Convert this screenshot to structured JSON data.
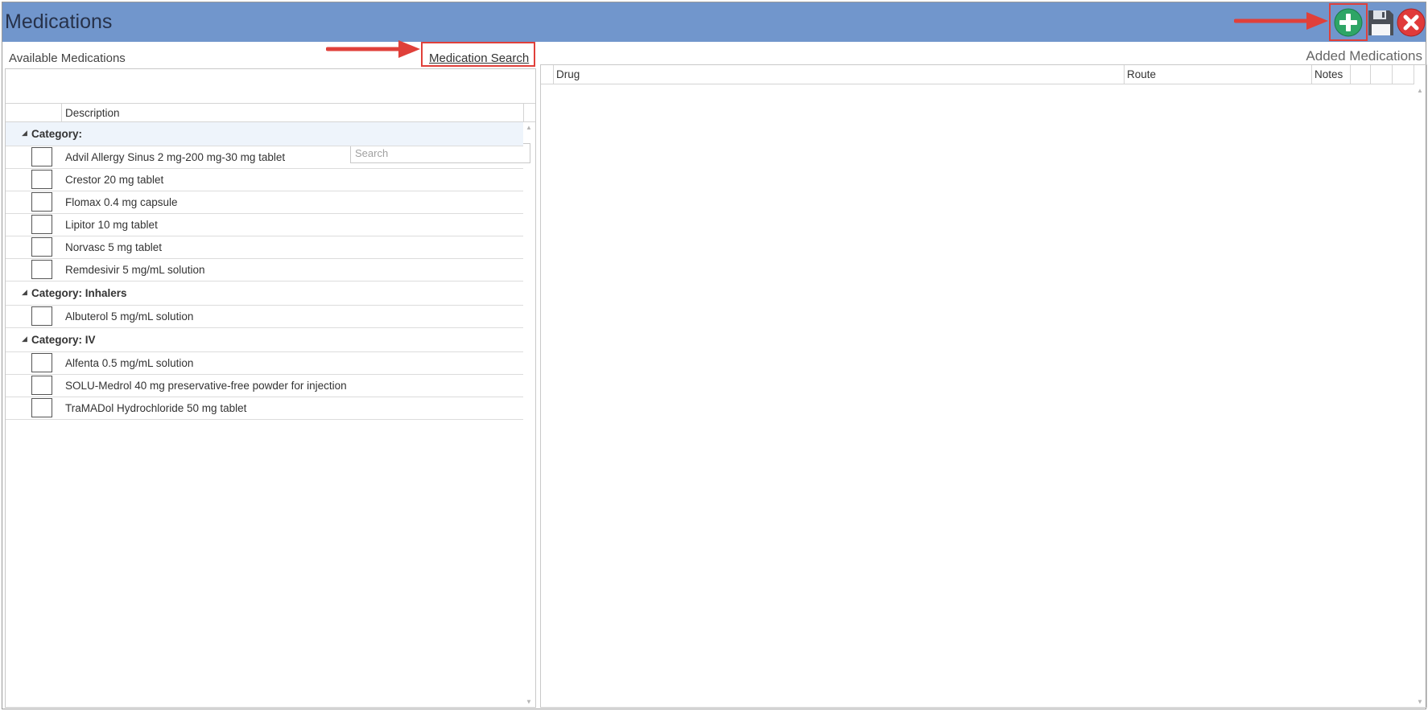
{
  "window": {
    "title": "Medications"
  },
  "toolbar": {
    "add_icon": "plus-circle-icon",
    "save_icon": "floppy-disk-icon",
    "close_icon": "close-circle-icon",
    "add_color": "#2ea566",
    "close_color": "#e03a3a"
  },
  "left": {
    "label": "Available Medications",
    "search_link": "Medication Search",
    "search_placeholder": "Search",
    "column_description": "Description",
    "groups": [
      {
        "category": "Category:",
        "items": [
          "Advil Allergy Sinus 2 mg-200 mg-30 mg tablet",
          "Crestor 20 mg tablet",
          "Flomax 0.4 mg capsule",
          "Lipitor 10 mg tablet",
          "Norvasc 5 mg tablet",
          "Remdesivir 5 mg/mL solution"
        ]
      },
      {
        "category": "Category: Inhalers",
        "items": [
          "Albuterol 5 mg/mL solution"
        ]
      },
      {
        "category": "Category: IV",
        "items": [
          "Alfenta 0.5 mg/mL solution",
          "SOLU-Medrol 40 mg preservative-free powder for injection",
          "TraMADol Hydrochloride 50 mg tablet"
        ]
      }
    ]
  },
  "right": {
    "label": "Added Medications",
    "columns": {
      "drug": "Drug",
      "route": "Route",
      "notes": "Notes"
    }
  },
  "annotation_color": "#e0403a"
}
